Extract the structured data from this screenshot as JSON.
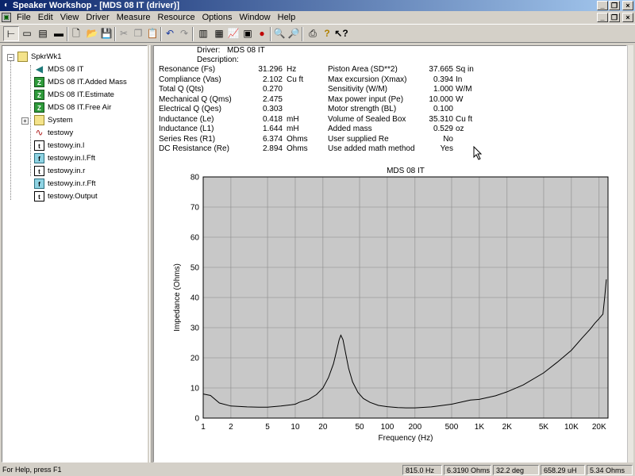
{
  "window": {
    "title": "Speaker Workshop - [MDS 08 IT (driver)]",
    "caption_buttons": [
      "_",
      "❐",
      "×"
    ],
    "mdi_caption_buttons": [
      "_",
      "❐",
      "×"
    ]
  },
  "menu": [
    "File",
    "Edit",
    "View",
    "Driver",
    "Measure",
    "Resource",
    "Options",
    "Window",
    "Help"
  ],
  "toolbar": {
    "buttons": [
      "tree-view",
      "small-icons-view",
      "list-view",
      "details-view",
      "new-document",
      "open-file",
      "save",
      "cut",
      "copy",
      "paste",
      "undo",
      "redo",
      "open-folder",
      "import",
      "chart-view",
      "print-preview",
      "record",
      "zoom-in",
      "zoom-out",
      "print",
      "help",
      "context-help"
    ]
  },
  "tree": {
    "root": "SpkrWk1",
    "items": [
      {
        "label": "MDS 08 IT",
        "icon": "speaker-icon"
      },
      {
        "label": "MDS 08 IT.Added Mass",
        "icon": "impedance-z-icon"
      },
      {
        "label": "MDS 08 IT.Estimate",
        "icon": "impedance-z-icon"
      },
      {
        "label": "MDS 08 IT.Free Air",
        "icon": "impedance-z-icon"
      },
      {
        "label": "System",
        "icon": "folder-icon"
      },
      {
        "label": "testowy",
        "icon": "signal-wave-icon"
      },
      {
        "label": "testowy.in.l",
        "icon": "text-t-icon"
      },
      {
        "label": "testowy.in.l.Fft",
        "icon": "fft-f-icon"
      },
      {
        "label": "testowy.in.r",
        "icon": "text-t-icon"
      },
      {
        "label": "testowy.in.r.Fft",
        "icon": "fft-f-icon"
      },
      {
        "label": "testowy.Output",
        "icon": "text-t-icon"
      }
    ],
    "expander_plus": "+",
    "expander_minus": "−"
  },
  "header": {
    "driver_label": "Driver:",
    "driver_value": "MDS 08 IT",
    "description_label": "Description:"
  },
  "params_left": [
    {
      "label": "Resonance (Fs)",
      "value": "31.296",
      "unit": "Hz"
    },
    {
      "label": "Compliance (Vas)",
      "value": "2.102",
      "unit": "Cu ft"
    },
    {
      "label": "Total Q (Qts)",
      "value": "0.270",
      "unit": ""
    },
    {
      "label": "Mechanical Q (Qms)",
      "value": "2.475",
      "unit": ""
    },
    {
      "label": "Electrical Q (Qes)",
      "value": "0.303",
      "unit": ""
    },
    {
      "label": "Inductance (Le)",
      "value": "0.418",
      "unit": "mH"
    },
    {
      "label": "Inductance (L1)",
      "value": "1.644",
      "unit": "mH"
    },
    {
      "label": "Series Res (R1)",
      "value": "6.374",
      "unit": "Ohms"
    },
    {
      "label": "DC Resistance (Re)",
      "value": "2.894",
      "unit": "Ohms"
    }
  ],
  "params_right": [
    {
      "label": "Piston Area (SD**2)",
      "value": "37.665",
      "unit": "Sq in"
    },
    {
      "label": "Max excursion (Xmax)",
      "value": "0.394",
      "unit": "In"
    },
    {
      "label": "Sensitivity (W/M)",
      "value": "1.000",
      "unit": "W/M"
    },
    {
      "label": "Max power input (Pe)",
      "value": "10.000",
      "unit": "W"
    },
    {
      "label": "Motor strength (BL)",
      "value": "0.100",
      "unit": ""
    },
    {
      "label": "Volume of Sealed Box",
      "value": "35.310",
      "unit": "Cu ft"
    },
    {
      "label": "Added mass",
      "value": "0.529",
      "unit": "oz"
    },
    {
      "label": "User supplied Re",
      "value": "No",
      "unit": ""
    },
    {
      "label": "Use added math method",
      "value": "Yes",
      "unit": ""
    }
  ],
  "chart_data": {
    "type": "line",
    "title": "MDS 08 IT",
    "xlabel": "Frequency (Hz)",
    "ylabel": "Impedance (Ohms)",
    "x_scale": "log",
    "xlim": [
      1,
      25000
    ],
    "ylim": [
      0,
      80
    ],
    "x_ticks": [
      {
        "v": 1,
        "label": "1"
      },
      {
        "v": 2,
        "label": "2"
      },
      {
        "v": 5,
        "label": "5"
      },
      {
        "v": 10,
        "label": "10"
      },
      {
        "v": 20,
        "label": "20"
      },
      {
        "v": 50,
        "label": "50"
      },
      {
        "v": 100,
        "label": "100"
      },
      {
        "v": 200,
        "label": "200"
      },
      {
        "v": 500,
        "label": "500"
      },
      {
        "v": 1000,
        "label": "1K"
      },
      {
        "v": 2000,
        "label": "2K"
      },
      {
        "v": 5000,
        "label": "5K"
      },
      {
        "v": 10000,
        "label": "10K"
      },
      {
        "v": 20000,
        "label": "20K"
      }
    ],
    "y_ticks": [
      0,
      10,
      20,
      30,
      40,
      50,
      60,
      70,
      80
    ],
    "grid": true,
    "plot_background": "#c8c8c8",
    "line_color": "#000000",
    "series": [
      {
        "x": [
          1,
          1.2,
          1.5,
          2,
          3,
          4,
          5,
          7,
          9,
          10,
          11,
          12,
          14,
          17,
          20,
          23,
          26,
          28,
          30,
          31.3,
          33,
          35,
          38,
          42,
          48,
          55,
          65,
          80,
          100,
          130,
          160,
          200,
          300,
          500,
          700,
          800,
          1000,
          1500,
          2000,
          3000,
          5000,
          7000,
          10000,
          13000,
          16000,
          18000,
          20000,
          22000,
          23000,
          24000
        ],
        "y": [
          8,
          7.5,
          5,
          4,
          3.7,
          3.6,
          3.6,
          4,
          4.4,
          4.6,
          5.2,
          5.6,
          6.2,
          7.8,
          10,
          13.5,
          18,
          22,
          26,
          27.5,
          26,
          22,
          16.5,
          12,
          8.5,
          6.5,
          5.2,
          4.2,
          3.8,
          3.5,
          3.4,
          3.4,
          3.7,
          4.6,
          5.6,
          6,
          6.2,
          7.4,
          8.7,
          11,
          15,
          18.5,
          22.5,
          26.5,
          29.5,
          31.5,
          33,
          34.5,
          40,
          46
        ]
      }
    ]
  },
  "status": {
    "help": "For Help, press F1",
    "freq": "815.0 Hz",
    "impedance": "6.3190 Ohms",
    "phase": "32.2 deg",
    "inductance": "658.29 uH",
    "resistance": "5.34 Ohms"
  },
  "colors": {
    "titlebar_start": "#0a246a",
    "titlebar_end": "#a6caf0",
    "chrome": "#d4d0c8",
    "plot_bg": "#c8c8c8"
  }
}
